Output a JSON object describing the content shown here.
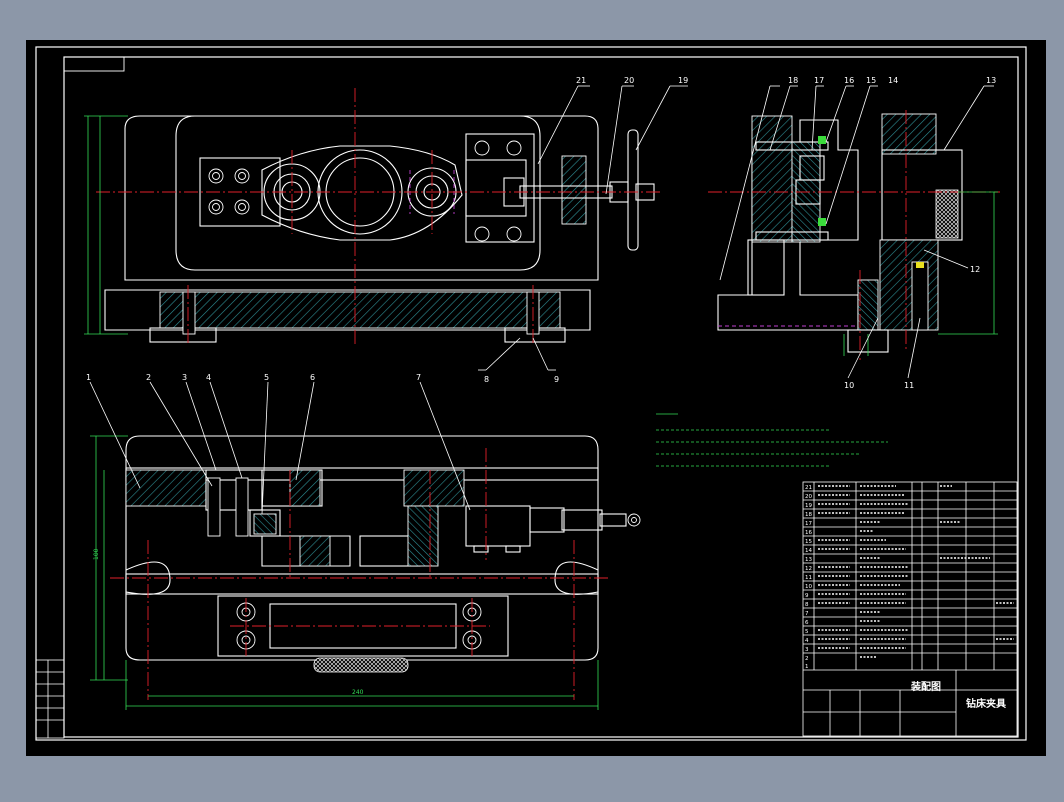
{
  "window": {
    "background_color": "#8c97a8",
    "canvas_color": "#000000",
    "centerline_color": "#e0202a",
    "dimension_color": "#33dd55",
    "hidden_line_color": "#c040d0",
    "highlight_color": "#e8e020"
  },
  "balloons": {
    "top_view": [
      "21",
      "20",
      "19"
    ],
    "side_view": [
      "18",
      "17",
      "16",
      "15",
      "14",
      "13",
      "12",
      "11",
      "10"
    ],
    "base_view": [
      "8",
      "9"
    ],
    "front_section": [
      "1",
      "2",
      "3",
      "4",
      "5",
      "6",
      "7"
    ]
  },
  "dimensions": {
    "base_width": "240",
    "front_height": "100"
  },
  "title_block": {
    "drawing_title": "装配图",
    "part_name": "钻床夹具",
    "row_numbers": [
      "21",
      "20",
      "19",
      "18",
      "17",
      "16",
      "15",
      "14",
      "13",
      "12",
      "11",
      "10",
      "9",
      "8",
      "7",
      "6",
      "5",
      "4",
      "3",
      "2",
      "1"
    ]
  }
}
